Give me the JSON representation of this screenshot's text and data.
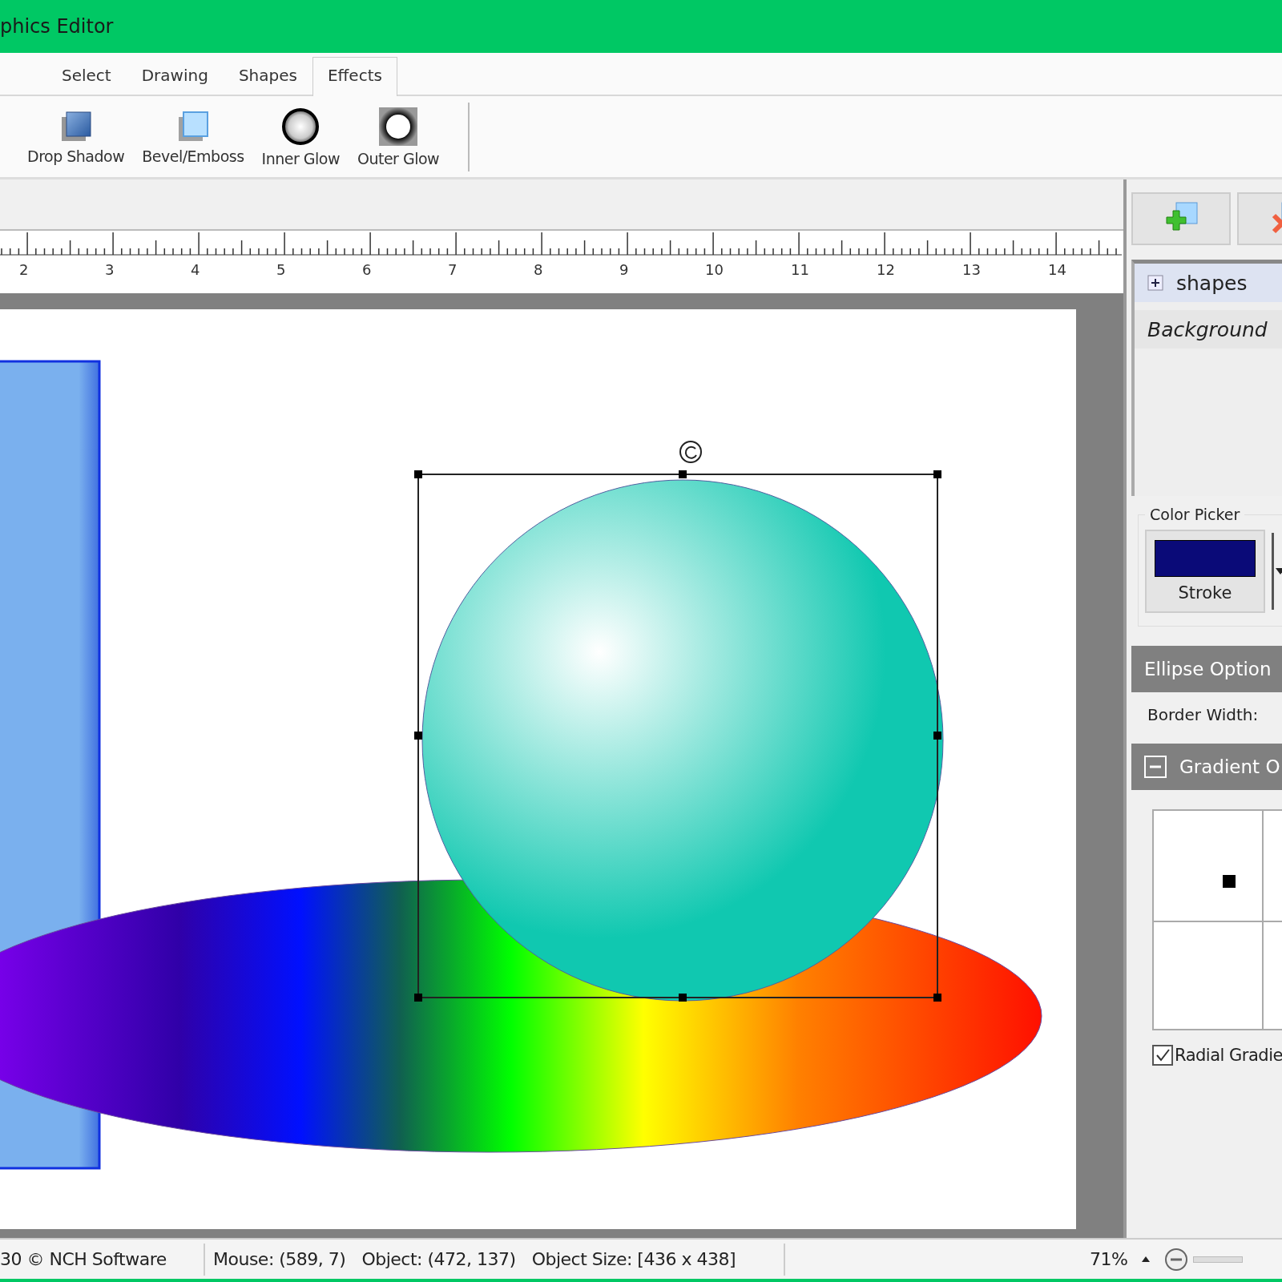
{
  "window": {
    "title": "phics Editor"
  },
  "tabs": [
    {
      "label": "Select",
      "selected": false
    },
    {
      "label": "Drawing",
      "selected": false
    },
    {
      "label": "Shapes",
      "selected": false
    },
    {
      "label": "Effects",
      "selected": true
    }
  ],
  "tools": [
    {
      "label": "Drop Shadow",
      "kind": "shadow"
    },
    {
      "label": "Bevel/Emboss",
      "kind": "bevel"
    },
    {
      "label": "Inner Glow",
      "kind": "inner"
    },
    {
      "label": "Outer Glow",
      "kind": "outer"
    }
  ],
  "ruler": {
    "labels": [
      "2",
      "3",
      "4",
      "5",
      "6",
      "7",
      "8",
      "9",
      "10",
      "11",
      "12",
      "13",
      "14"
    ]
  },
  "layers": [
    {
      "label": "shapes",
      "kind": "group",
      "expanded": false,
      "selected": true
    },
    {
      "label": "Background",
      "kind": "background",
      "selected": false
    }
  ],
  "color_picker": {
    "title": "Color Picker",
    "swatch": {
      "label": "Stroke",
      "color": "#0a0a78"
    }
  },
  "ellipse_options": {
    "title": "Ellipse Option",
    "border_width_label": "Border Width:"
  },
  "gradient_options": {
    "title": "Gradient O",
    "expanded": true,
    "radial": {
      "label": "Radial Gradie",
      "checked": true
    }
  },
  "status_bar": {
    "copyright": "30 © NCH Software",
    "mouse": "Mouse: (589, 7)",
    "object": "Object: (472, 137)",
    "object_size": "Object Size: [436 x 438]",
    "zoom": "71%"
  }
}
